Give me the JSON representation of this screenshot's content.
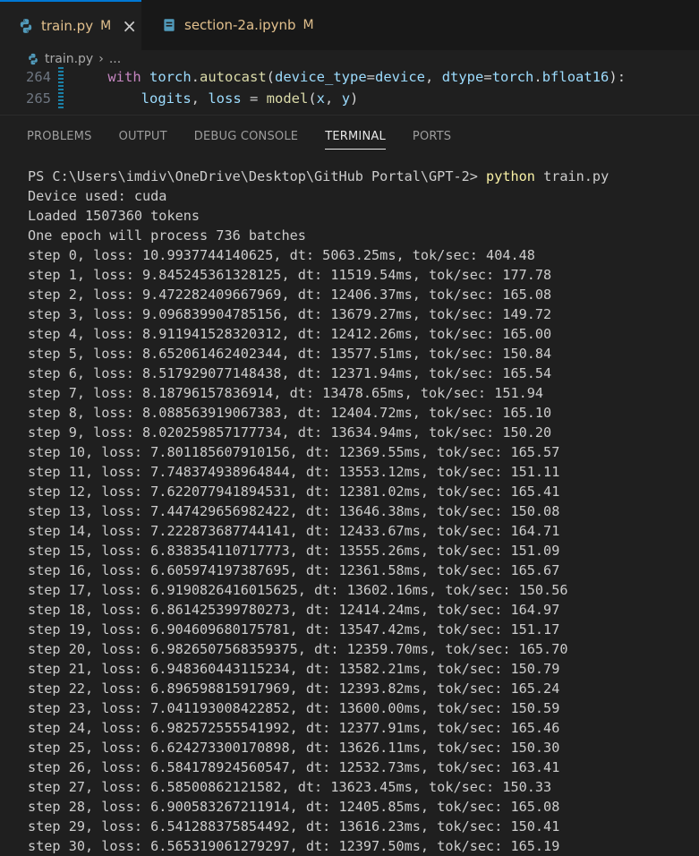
{
  "tabs": [
    {
      "label": "train.py",
      "modified": "M",
      "active": true
    },
    {
      "label": "section-2a.ipynb",
      "modified": "M",
      "active": false
    }
  ],
  "breadcrumb": {
    "file": "train.py",
    "more": "..."
  },
  "editor": {
    "lines": [
      {
        "number": "264"
      },
      {
        "number": "265"
      }
    ]
  },
  "panel": {
    "tabs": [
      "PROBLEMS",
      "OUTPUT",
      "DEBUG CONSOLE",
      "TERMINAL",
      "PORTS"
    ],
    "active_tab": "TERMINAL"
  },
  "terminal": {
    "prompt": "PS C:\\Users\\imdiv\\OneDrive\\Desktop\\GitHub Portal\\GPT-2> ",
    "command": "python",
    "command_arg": " train.py",
    "output": [
      "Device used: cuda",
      "Loaded 1507360 tokens",
      "One epoch will process 736 batches",
      "step 0, loss: 10.9937744140625, dt: 5063.25ms, tok/sec: 404.48",
      "step 1, loss: 9.845245361328125, dt: 11519.54ms, tok/sec: 177.78",
      "step 2, loss: 9.472282409667969, dt: 12406.37ms, tok/sec: 165.08",
      "step 3, loss: 9.096839904785156, dt: 13679.27ms, tok/sec: 149.72",
      "step 4, loss: 8.911941528320312, dt: 12412.26ms, tok/sec: 165.00",
      "step 5, loss: 8.652061462402344, dt: 13577.51ms, tok/sec: 150.84",
      "step 6, loss: 8.517929077148438, dt: 12371.94ms, tok/sec: 165.54",
      "step 7, loss: 8.18796157836914, dt: 13478.65ms, tok/sec: 151.94",
      "step 8, loss: 8.088563919067383, dt: 12404.72ms, tok/sec: 165.10",
      "step 9, loss: 8.020259857177734, dt: 13634.94ms, tok/sec: 150.20",
      "step 10, loss: 7.801185607910156, dt: 12369.55ms, tok/sec: 165.57",
      "step 11, loss: 7.748374938964844, dt: 13553.12ms, tok/sec: 151.11",
      "step 12, loss: 7.622077941894531, dt: 12381.02ms, tok/sec: 165.41",
      "step 13, loss: 7.447429656982422, dt: 13646.38ms, tok/sec: 150.08",
      "step 14, loss: 7.222873687744141, dt: 12433.67ms, tok/sec: 164.71",
      "step 15, loss: 6.838354110717773, dt: 13555.26ms, tok/sec: 151.09",
      "step 16, loss: 6.605974197387695, dt: 12361.58ms, tok/sec: 165.67",
      "step 17, loss: 6.9190826416015625, dt: 13602.16ms, tok/sec: 150.56",
      "step 18, loss: 6.861425399780273, dt: 12414.24ms, tok/sec: 164.97",
      "step 19, loss: 6.904609680175781, dt: 13547.42ms, tok/sec: 151.17",
      "step 20, loss: 6.9826507568359375, dt: 12359.70ms, tok/sec: 165.70",
      "step 21, loss: 6.948360443115234, dt: 13582.21ms, tok/sec: 150.79",
      "step 22, loss: 6.896598815917969, dt: 12393.82ms, tok/sec: 165.24",
      "step 23, loss: 7.041193008422852, dt: 13600.00ms, tok/sec: 150.59",
      "step 24, loss: 6.982572555541992, dt: 12377.91ms, tok/sec: 165.46",
      "step 25, loss: 6.624273300170898, dt: 13626.11ms, tok/sec: 150.30",
      "step 26, loss: 6.584178924560547, dt: 12532.73ms, tok/sec: 163.41",
      "step 27, loss: 6.58500862121582, dt: 13623.45ms, tok/sec: 150.33",
      "step 28, loss: 6.900583267211914, dt: 12405.85ms, tok/sec: 165.08",
      "step 29, loss: 6.541288375854492, dt: 13616.23ms, tok/sec: 150.41",
      "step 30, loss: 6.565319061279297, dt: 12397.50ms, tok/sec: 165.19"
    ]
  },
  "colors": {
    "accent": "#0078d4",
    "modified": "#e2c08d",
    "command": "#f9f1a5"
  },
  "icons": {
    "tab_python": "python-icon",
    "tab_notebook": "notebook-icon",
    "close": "close-icon"
  }
}
